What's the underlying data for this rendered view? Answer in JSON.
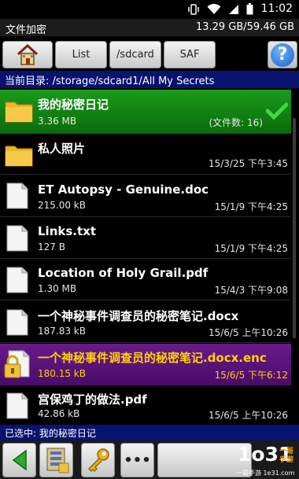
{
  "status_bar": {
    "time": "11:02",
    "icons": [
      "vibrate-icon",
      "wifi-icon",
      "signal-icon",
      "battery-icon"
    ]
  },
  "title_bar": {
    "app_title": "文件加密",
    "storage": "13.29 GB/59.46 GB"
  },
  "toolbar": {
    "home_icon": "home-icon",
    "list_label": "List",
    "sdcard_label": "/sdcard",
    "saf_label": "SAF",
    "help_label": "?"
  },
  "path_bar": {
    "text": "当前目录: /storage/sdcard1/All My Secrets"
  },
  "files": [
    {
      "name": "我的秘密日记",
      "size": "3.36 MB",
      "date": "(文件数: 16)",
      "type": "folder",
      "selected": true
    },
    {
      "name": "私人照片",
      "size": "",
      "date": "15/3/25 下午3:45",
      "type": "folder"
    },
    {
      "name": "ET Autopsy - Genuine.doc",
      "size": "215.00 kB",
      "date": "15/1/9 下午4:25",
      "type": "file"
    },
    {
      "name": "Links.txt",
      "size": "127 B",
      "date": "15/1/9 下午4:25",
      "type": "file"
    },
    {
      "name": "Location of Holy Grail.pdf",
      "size": "1.30 MB",
      "date": "15/4/3 下午9:08",
      "type": "file"
    },
    {
      "name": "一个神秘事件调查员的秘密笔记.docx",
      "size": "187.83 kB",
      "date": "15/6/5 上午10:26",
      "type": "file"
    },
    {
      "name": "一个神秘事件调查员的秘密笔记.docx.enc",
      "size": "180.15 kB",
      "date": "15/6/5 下午6:12",
      "type": "encrypted"
    },
    {
      "name": "宫保鸡丁的做法.pdf",
      "size": "42.86 kB",
      "date": "15/6/5 上午10:26",
      "type": "file"
    }
  ],
  "selected_bar": {
    "text": "已选中: 我的秘密日记"
  },
  "bottom_bar": {
    "more_label": "•••"
  },
  "watermark": {
    "main": "1o31",
    "side_top": "一哥",
    "side_bottom": "手游",
    "url": "一哥手游 1e31.com"
  },
  "colors": {
    "path_bar_bg": "#08126f",
    "selected_folder_bg": "#1b9b1b",
    "selected_file_bg": "#6a1b8a",
    "selected_file_text": "#ffd200",
    "check": "#37c837"
  }
}
